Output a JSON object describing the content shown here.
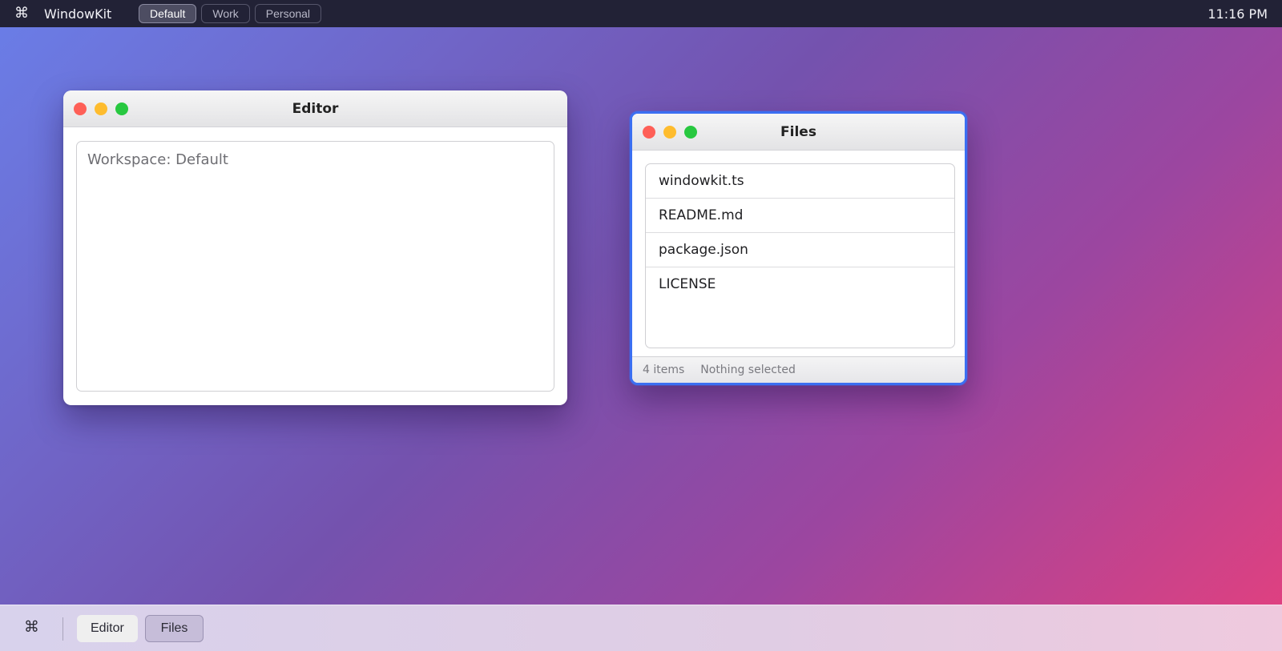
{
  "menubar": {
    "logo_glyph": "⌘",
    "app_name": "WindowKit",
    "workspaces": [
      {
        "label": "Default",
        "active": true
      },
      {
        "label": "Work",
        "active": false
      },
      {
        "label": "Personal",
        "active": false
      }
    ],
    "clock": "11:16 PM"
  },
  "editor_window": {
    "title": "Editor",
    "content": "Workspace: Default"
  },
  "files_window": {
    "title": "Files",
    "focused": true,
    "files": [
      "windowkit.ts",
      "README.md",
      "package.json",
      "LICENSE"
    ],
    "status": {
      "count": "4 items",
      "selection": "Nothing selected"
    }
  },
  "dock": {
    "logo_glyph": "⌘",
    "items": [
      {
        "label": "Editor",
        "active": false
      },
      {
        "label": "Files",
        "active": true
      }
    ]
  },
  "colors": {
    "focus_ring": "#3b6ff2",
    "close": "#fe5f57",
    "minimize": "#febc2e",
    "maximize": "#28c840"
  }
}
